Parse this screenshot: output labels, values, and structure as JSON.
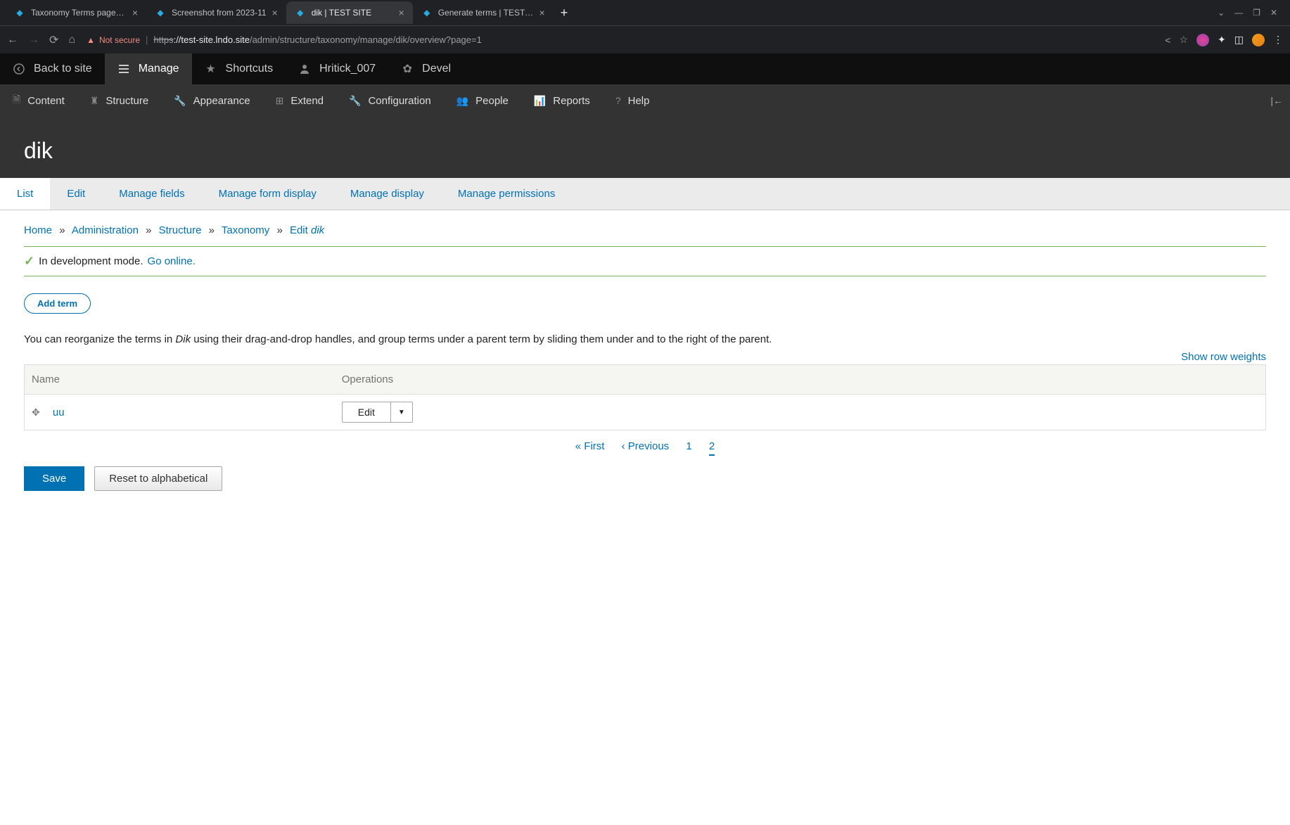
{
  "browser": {
    "tabs": [
      {
        "title": "Taxonomy Terms page pa",
        "active": false
      },
      {
        "title": "Screenshot from 2023-11",
        "active": false
      },
      {
        "title": "dik | TEST SITE",
        "active": true
      },
      {
        "title": "Generate terms | TEST SIT",
        "active": false
      }
    ],
    "not_secure": "Not secure",
    "url_proto": "https",
    "url_host": "://test-site.lndo.site",
    "url_path": "/admin/structure/taxonomy/manage/dik/overview?page=1"
  },
  "toolbar": {
    "back_to_site": "Back to site",
    "manage": "Manage",
    "shortcuts": "Shortcuts",
    "user": "Hritick_007",
    "devel": "Devel",
    "admin_menu": {
      "content": "Content",
      "structure": "Structure",
      "appearance": "Appearance",
      "extend": "Extend",
      "configuration": "Configuration",
      "people": "People",
      "reports": "Reports",
      "help": "Help"
    }
  },
  "page": {
    "title": "dik",
    "tabs": {
      "list": "List",
      "edit": "Edit",
      "manage_fields": "Manage fields",
      "manage_form_display": "Manage form display",
      "manage_display": "Manage display",
      "manage_permissions": "Manage permissions"
    },
    "breadcrumb": {
      "home": "Home",
      "administration": "Administration",
      "structure": "Structure",
      "taxonomy": "Taxonomy",
      "edit": "Edit",
      "current": "dik"
    },
    "status_prefix": "In development mode.",
    "status_link": "Go online.",
    "add_term": "Add term",
    "help_prefix": "You can reorganize the terms in ",
    "help_em": "Dik",
    "help_suffix": " using their drag-and-drop handles, and group terms under a parent term by sliding them under and to the right of the parent.",
    "show_weights": "Show row weights",
    "table": {
      "col_name": "Name",
      "col_ops": "Operations",
      "rows": [
        {
          "name": "uu",
          "op": "Edit"
        }
      ]
    },
    "pager": {
      "first": "« First",
      "prev": "‹ Previous",
      "p1": "1",
      "p2": "2"
    },
    "save": "Save",
    "reset": "Reset to alphabetical"
  }
}
